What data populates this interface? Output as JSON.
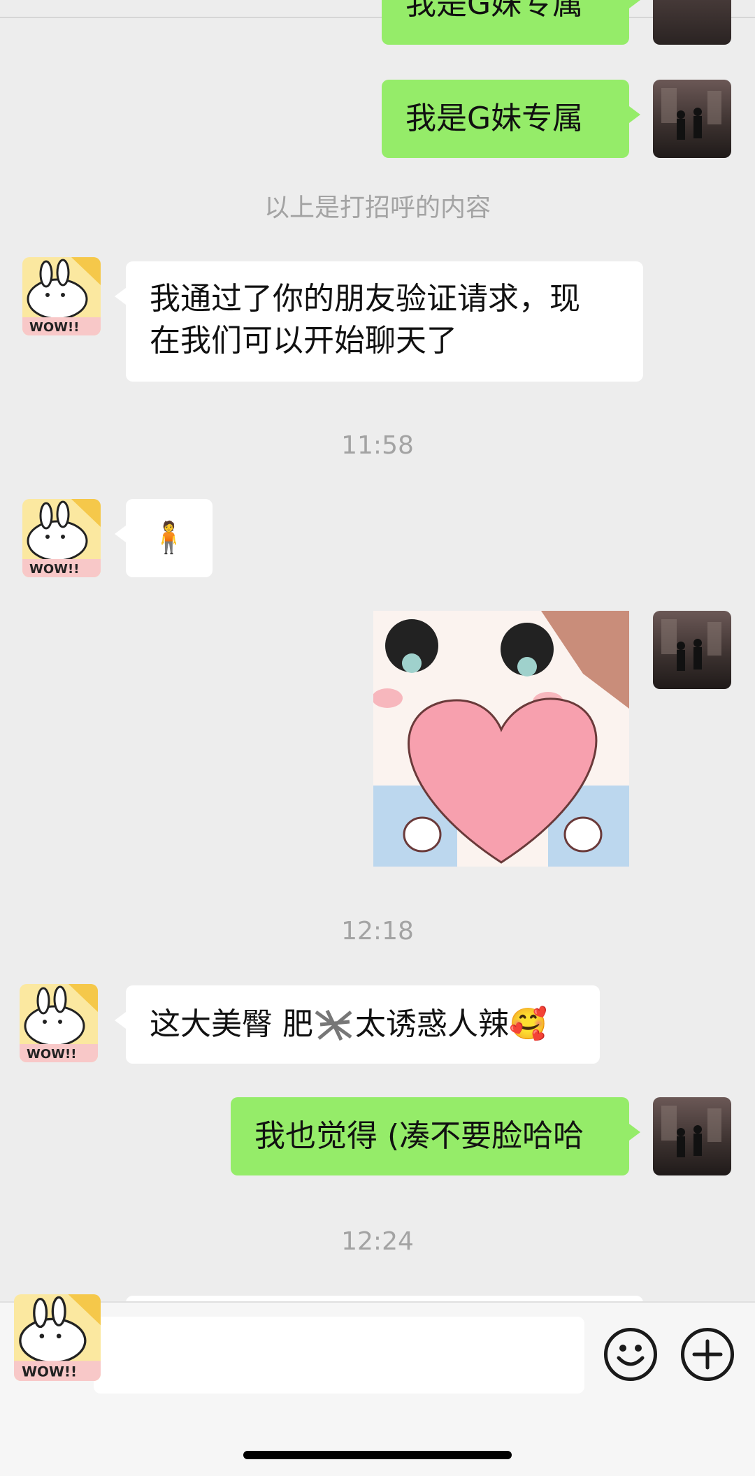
{
  "messages": {
    "m1_text": "我是G妹专属",
    "m2_text": "我是G妹专属",
    "system_note": "以上是打招呼的内容",
    "m3_line1": "我通过了你的朋友验证请求，现",
    "m3_line2": "在我们可以开始聊天了",
    "time1": "11:58",
    "m4_emoji": "🧍",
    "time2": "12:18",
    "m6_text_a": "这大美臀 肥",
    "m6_text_b": "太诱惑人辣",
    "m6_emoji": "🥰",
    "m7_text": "我也觉得 (凑不要脸哈哈",
    "time3": "12:24"
  },
  "avatars": {
    "contact_text": "WOW!!"
  },
  "icons": {
    "emoji_button": "smiley-face-icon",
    "plus_button": "plus-circle-icon"
  },
  "colors": {
    "background": "#ededed",
    "incoming_bubble": "#ffffff",
    "outgoing_bubble": "#95ec69",
    "timestamp": "#a3a3a3"
  }
}
